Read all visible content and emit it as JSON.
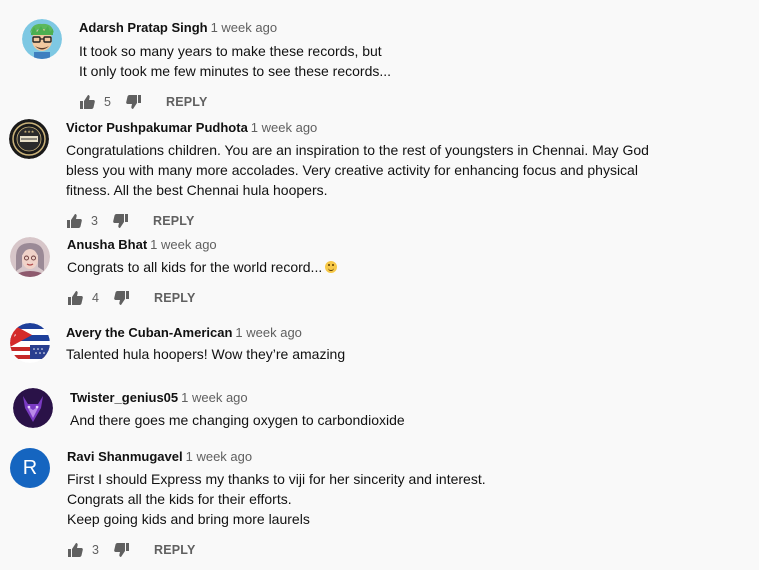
{
  "reply_label": "REPLY",
  "comments": [
    {
      "author": "Adarsh Pratap Singh",
      "time": "1 week ago",
      "text": "It took so many years to make these records, but\nIt only took me few minutes to see these records...",
      "likes": "5",
      "avatar_icon": "cartoon-boy-avatar-icon"
    },
    {
      "author": "Victor Pushpakumar Pudhota",
      "time": "1 week ago",
      "text": "Congratulations children.  You are an inspiration to the rest of youngsters in Chennai. May God\nbless you with many more accolades. Very creative  activity for enhancing focus and physical\nfitness. All the best Chennai hula hoopers.",
      "likes": "3",
      "avatar_icon": "badge-emblem-avatar-icon"
    },
    {
      "author": "Anusha Bhat",
      "time": "1 week ago",
      "text": "Congrats to all kids for the world record...",
      "likes": "4",
      "avatar_icon": "photo-avatar-icon"
    },
    {
      "author": "Avery the Cuban-American",
      "time": "1 week ago",
      "text": "Talented hula hoopers! Wow they’re amazing",
      "likes": "",
      "avatar_icon": "flag-avatar-icon"
    },
    {
      "author": "Twister_genius05",
      "time": "1 week ago",
      "text": "And there goes me changing oxygen to carbondioxide",
      "likes": "",
      "avatar_icon": "purple-wolf-avatar-icon"
    },
    {
      "author": "Ravi Shanmugavel",
      "time": "1 week ago",
      "text": "First I should Express my thanks to viji for her sincerity and interest.\nCongrats all the kids for their efforts.\nKeep going kids and bring more laurels",
      "likes": "3",
      "avatar_letter": "R",
      "avatar_color": "#1565c0",
      "avatar_icon": "letter-avatar-icon"
    }
  ]
}
